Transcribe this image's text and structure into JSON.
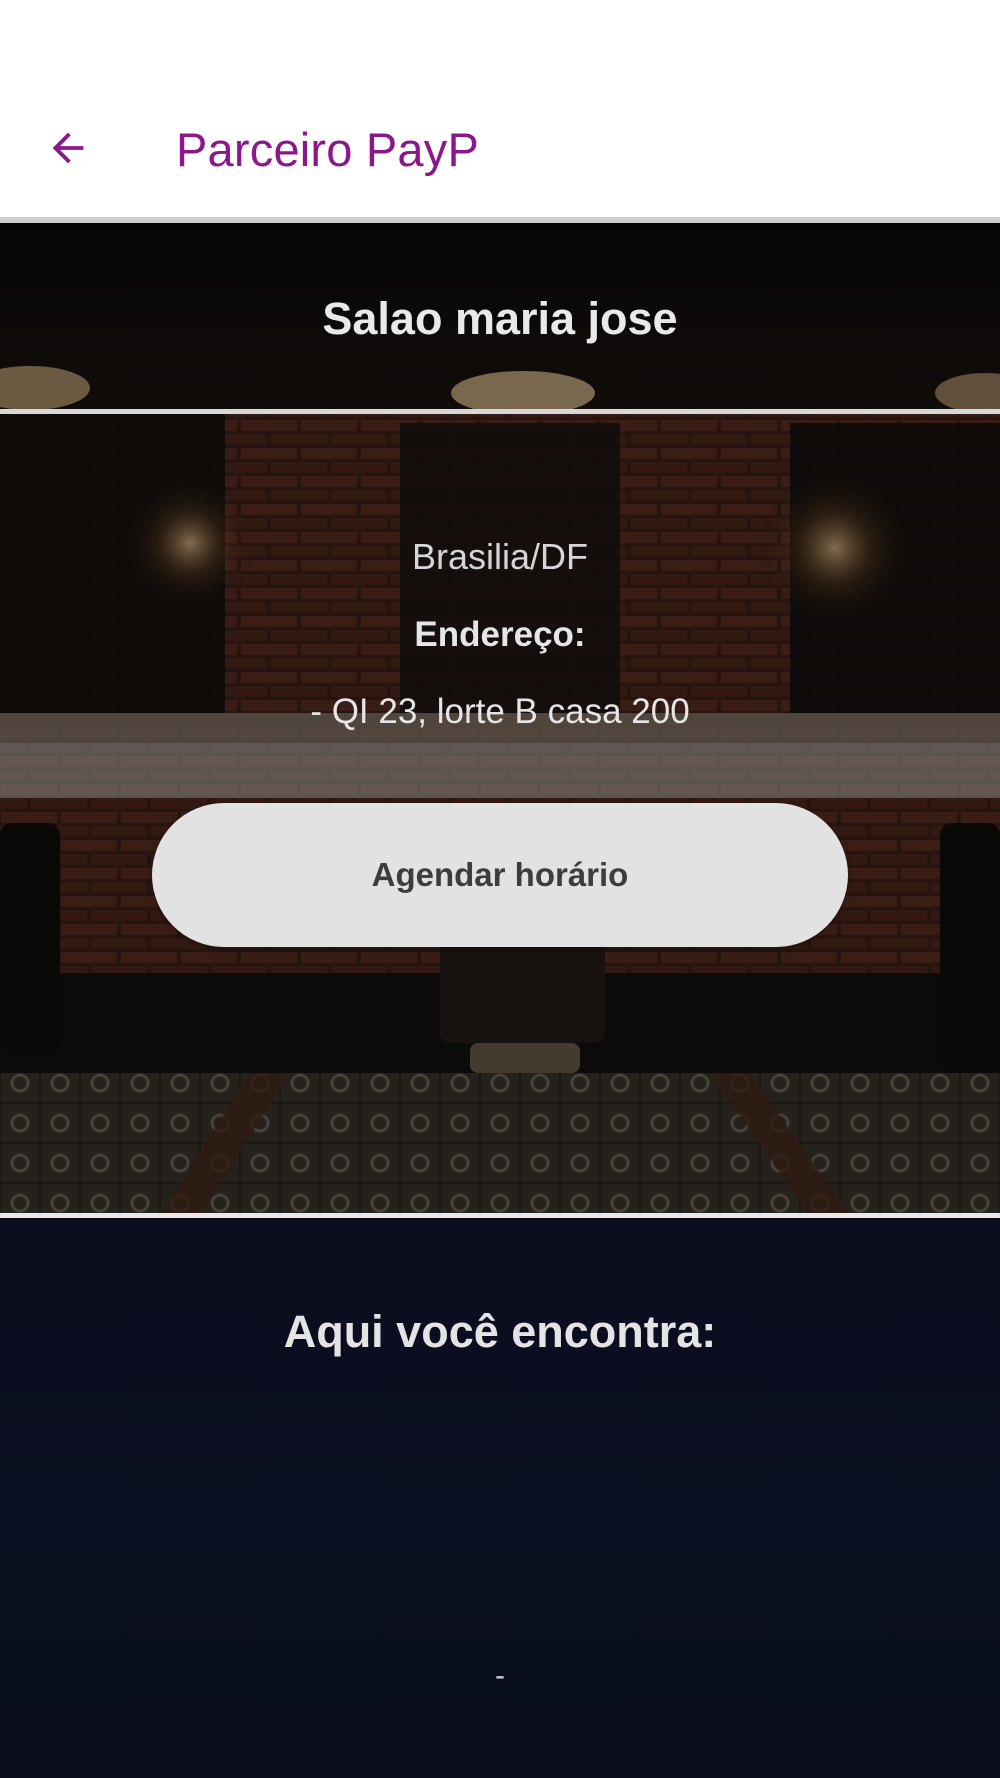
{
  "app_bar": {
    "title": "Parceiro PayP",
    "back_icon": "arrow-left-icon",
    "title_color": "#8a178c"
  },
  "salon": {
    "name": "Salao maria jose",
    "city": "Brasilia/DF",
    "address_label": "Endereço:",
    "address": "- QI 23, lorte B casa 200",
    "schedule_button_label": "Agendar horário"
  },
  "services": {
    "heading": "Aqui você encontra:",
    "items": [
      "-"
    ]
  }
}
